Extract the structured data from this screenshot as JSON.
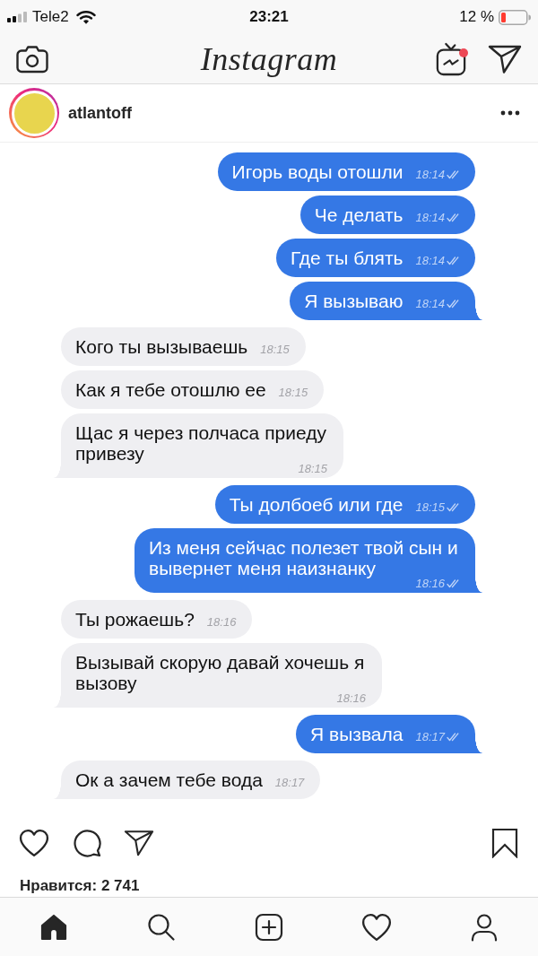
{
  "status_bar": {
    "carrier": "Tele2",
    "time": "23:21",
    "battery": "12 %"
  },
  "header": {
    "logo": "Instagram",
    "igtv_new": true
  },
  "post": {
    "user": {
      "username": "atlantoff",
      "story_ring": true
    },
    "image": {
      "messages": [
        {
          "kind": "sent",
          "text": "Игорь воды отошли",
          "time": "18:14",
          "checkmarks": true
        },
        {
          "kind": "sent",
          "text": "Че делать",
          "time": "18:14",
          "checkmarks": true
        },
        {
          "kind": "sent",
          "text": "Где ты блять",
          "time": "18:14",
          "checkmarks": true
        },
        {
          "kind": "sent",
          "text": "Я вызываю",
          "time": "18:14",
          "checkmarks": true
        },
        {
          "kind": "received",
          "text": "Кого ты вызываешь",
          "time": "18:15",
          "checkmarks": false
        },
        {
          "kind": "received",
          "text": "Как я тебе отошлю ее",
          "time": "18:15",
          "checkmarks": false
        },
        {
          "kind": "received",
          "text": "Щас я через полчаса приеду привезу",
          "time": "18:15",
          "checkmarks": false
        },
        {
          "kind": "sent",
          "text": "Ты долбоеб или где",
          "time": "18:15",
          "checkmarks": true
        },
        {
          "kind": "sent",
          "text": "Из меня сейчас полезет твой сын и вывернет меня наизнанку",
          "time": "18:16",
          "checkmarks": true
        },
        {
          "kind": "received",
          "text": "Ты рожаешь?",
          "time": "18:16",
          "checkmarks": false
        },
        {
          "kind": "received",
          "text": "Вызывай скорую давай хочешь я вызову",
          "time": "18:16",
          "checkmarks": false
        },
        {
          "kind": "sent",
          "text": "Я вызвала",
          "time": "18:17",
          "checkmarks": true
        },
        {
          "kind": "received",
          "text": "Ок а зачем тебе вода",
          "time": "18:17",
          "checkmarks": false
        }
      ]
    },
    "liked": false,
    "saved": false,
    "likes": "Нравится: 2 741"
  },
  "tabs": [
    {
      "kind": "home",
      "selected": true
    },
    {
      "kind": "search",
      "selected": false
    },
    {
      "kind": "add",
      "selected": false
    },
    {
      "kind": "activity",
      "selected": false
    },
    {
      "kind": "profile",
      "selected": false
    }
  ]
}
